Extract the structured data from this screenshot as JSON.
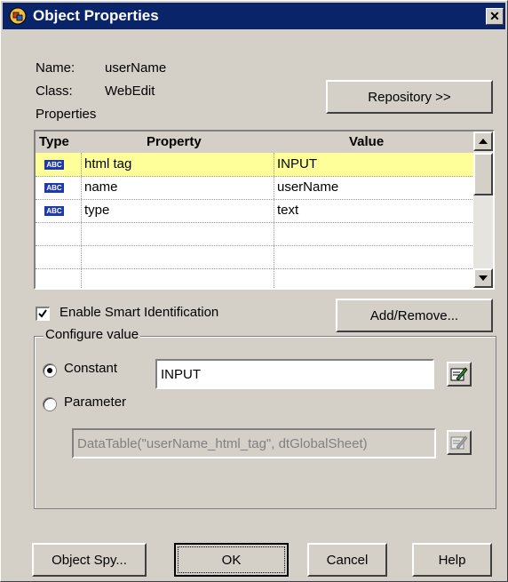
{
  "window": {
    "title": "Object Properties",
    "close_glyph": "✕"
  },
  "info": {
    "name_label": "Name:",
    "name_value": "userName",
    "class_label": "Class:",
    "class_value": "WebEdit",
    "properties_label": "Properties"
  },
  "buttons": {
    "repository": "Repository >>",
    "add_remove": "Add/Remove...",
    "object_spy": "Object Spy...",
    "ok": "OK",
    "cancel": "Cancel",
    "help": "Help"
  },
  "table": {
    "headers": {
      "type": "Type",
      "property": "Property",
      "value": "Value"
    },
    "type_badge": "ABC",
    "rows": [
      {
        "property": "html tag",
        "value": "INPUT"
      },
      {
        "property": "name",
        "value": "userName"
      },
      {
        "property": "type",
        "value": "text"
      }
    ]
  },
  "smart_id": {
    "label": "Enable Smart Identification",
    "checked": true
  },
  "configure": {
    "group_label": "Configure value",
    "constant_label": "Constant",
    "constant_value": "INPUT",
    "parameter_label": "Parameter",
    "parameter_value": "DataTable(\"userName_html_tag\", dtGlobalSheet)",
    "selected": "constant"
  },
  "icons": {
    "app": "objects-icon",
    "edit": "edit-pencil-icon"
  },
  "colors": {
    "title_bar": "#0a246a",
    "selected_row": "#ffff99",
    "badge": "#1e3aa8"
  }
}
